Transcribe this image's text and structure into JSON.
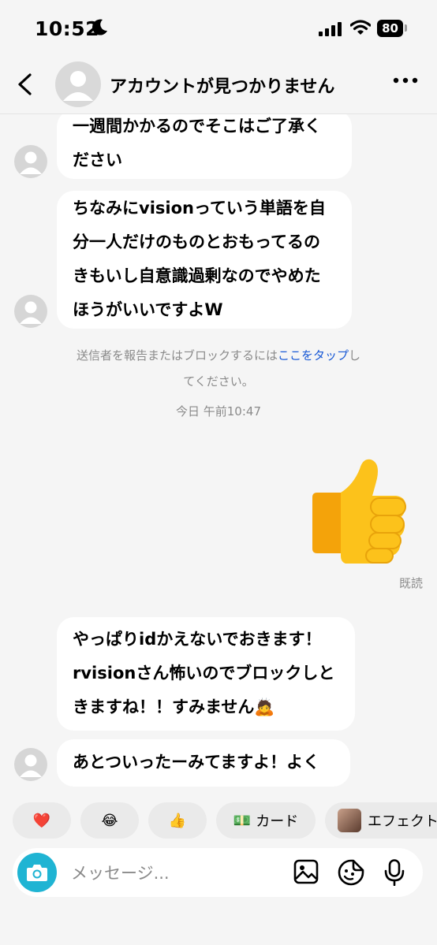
{
  "status": {
    "time": "10:52",
    "battery": "80"
  },
  "header": {
    "title": "アカウントが見つかりません"
  },
  "messages": {
    "m1": [
      "一週間かかるのでそこはご了承く",
      "ださい"
    ],
    "m2": [
      "ちなみにvisionっていう単語を自",
      "分一人だけのものとおもってるの",
      "きもいし自意識過剰なのでやめた",
      "ほうがいいですよW"
    ],
    "m3": [
      "やっぱりidかえないでおきます！",
      "rvisionさん怖いのでブロックしと",
      "きますね！！すみません🙇"
    ],
    "m4": [
      "あとついったーみてますよ！よく"
    ]
  },
  "notice": {
    "before": "送信者を報告またはブロックするには",
    "link": "ここをタップ",
    "after": "し",
    "line2": "てください。"
  },
  "timestamp": "今日 午前10:47",
  "sent_emoji": "👍",
  "seen": "既読",
  "reactions": {
    "heart": "❤️",
    "laugh": "😂",
    "thumbs": "👍",
    "card_icon": "💵",
    "card_label": "カード",
    "effect_label": "エフェクト"
  },
  "composer": {
    "placeholder": "メッセージ..."
  },
  "icons": [
    "moon-icon",
    "signal-icon",
    "wifi-icon",
    "back-arrow-icon",
    "more-icon",
    "camera-icon",
    "gallery-icon",
    "sticker-icon",
    "microphone-icon"
  ]
}
